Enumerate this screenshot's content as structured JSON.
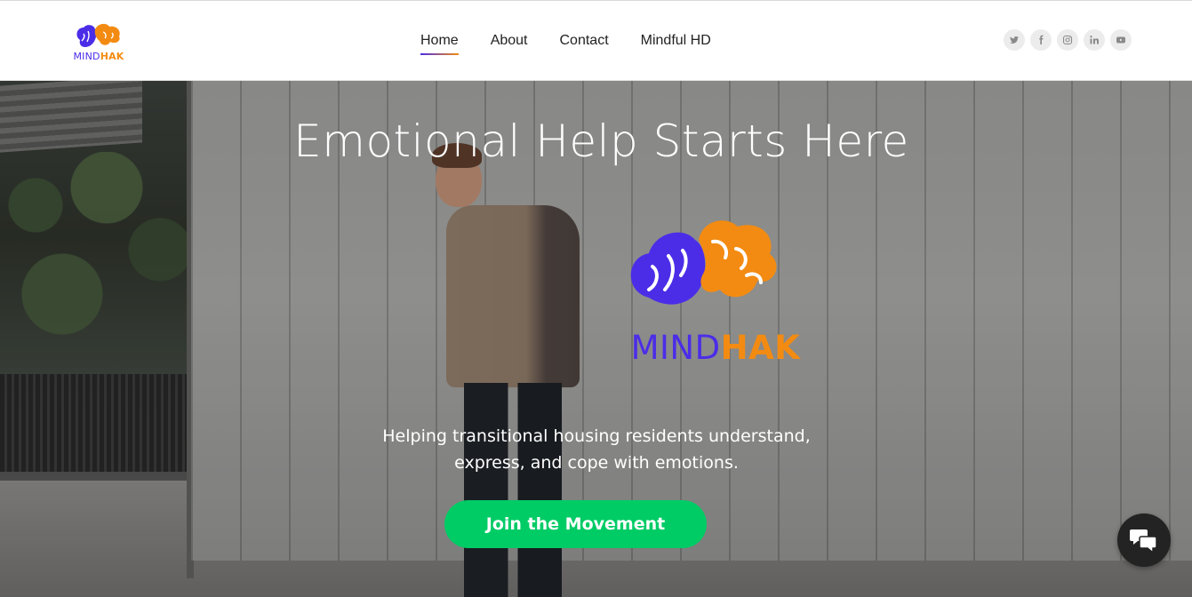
{
  "header": {
    "logo": {
      "mind": "MIND",
      "hak": "HAK"
    },
    "nav": [
      {
        "label": "Home",
        "active": true
      },
      {
        "label": "About",
        "active": false
      },
      {
        "label": "Contact",
        "active": false
      },
      {
        "label": "Mindful HD",
        "active": false
      }
    ],
    "socials": [
      "twitter-icon",
      "facebook-icon",
      "instagram-icon",
      "linkedin-icon",
      "youtube-icon"
    ]
  },
  "hero": {
    "title": "Emotional Help Starts Here",
    "logo": {
      "mind": "MIND",
      "hak": "HAK"
    },
    "subtitle_line1": "Helping transitional housing residents understand,",
    "subtitle_line2": "express, and cope with emotions.",
    "cta_label": "Join the Movement"
  },
  "colors": {
    "brand_purple": "#4b2de8",
    "brand_orange": "#f38b12",
    "cta_green": "#00cc66",
    "chat_bg": "#232323"
  },
  "chat_widget": {
    "icon": "chat-bubbles-icon"
  }
}
